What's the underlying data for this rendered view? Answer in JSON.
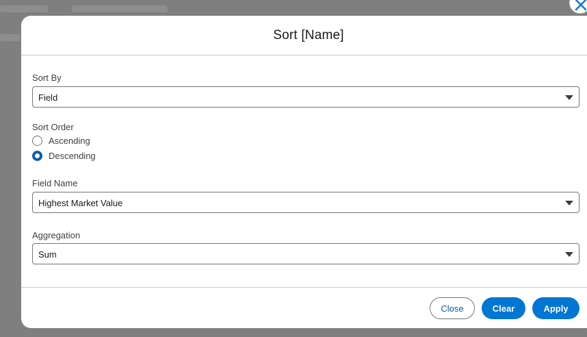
{
  "modal": {
    "title": "Sort [Name]",
    "sort_by": {
      "label": "Sort By",
      "value": "Field"
    },
    "sort_order": {
      "label": "Sort Order",
      "options": [
        {
          "label": "Ascending",
          "checked": false
        },
        {
          "label": "Descending",
          "checked": true
        }
      ]
    },
    "field_name": {
      "label": "Field Name",
      "value": "Highest Market Value"
    },
    "aggregation": {
      "label": "Aggregation",
      "value": "Sum"
    },
    "buttons": {
      "close": "Close",
      "clear": "Clear",
      "apply": "Apply"
    }
  },
  "icons": {
    "dismiss": "close-icon",
    "caret": "chevron-down-icon"
  },
  "colors": {
    "primary": "#0176d3",
    "radio_checked": "#0b5cab",
    "overlay": "#7f7f7f"
  }
}
